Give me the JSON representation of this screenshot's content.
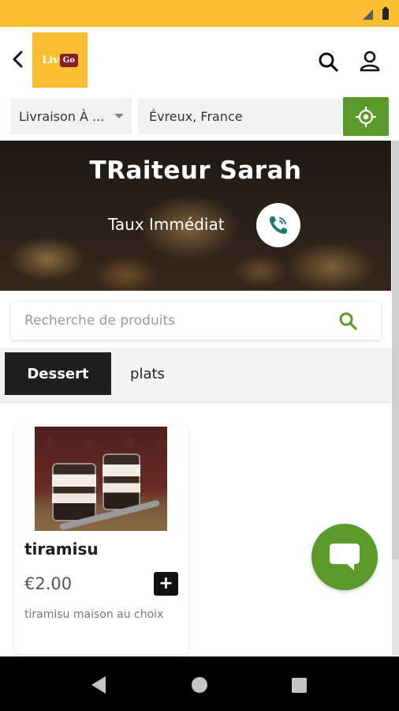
{
  "status_bar": {
    "color": "#fbbd32"
  },
  "header": {
    "back_icon": "chevron-left-icon",
    "logo": {
      "text": "Liv",
      "badge": "Go"
    },
    "search_icon": "search-icon",
    "account_icon": "user-icon"
  },
  "location": {
    "delivery_mode": "Livraison À ...",
    "city": "Évreux, France",
    "locate_icon": "crosshair-icon",
    "accent": "#5a9a2a"
  },
  "restaurant": {
    "name": "TRaiteur Sarah",
    "rate_label": "Taux Immédiat",
    "call_icon": "phone-icon"
  },
  "product_search": {
    "placeholder": "Recherche de produits",
    "search_icon": "search-icon"
  },
  "categories": {
    "tabs": [
      {
        "label": "Dessert",
        "active": true
      },
      {
        "label": "plats",
        "active": false
      }
    ]
  },
  "products": [
    {
      "name": "tiramisu",
      "price": "€2.00",
      "description": "tiramisu maison au choix",
      "add_label": "+"
    }
  ],
  "chat": {
    "icon": "chat-bubble-icon",
    "color": "#5a9a2a"
  },
  "system_nav": {
    "back": "triangle-back-icon",
    "home": "circle-home-icon",
    "recents": "square-recents-icon"
  }
}
